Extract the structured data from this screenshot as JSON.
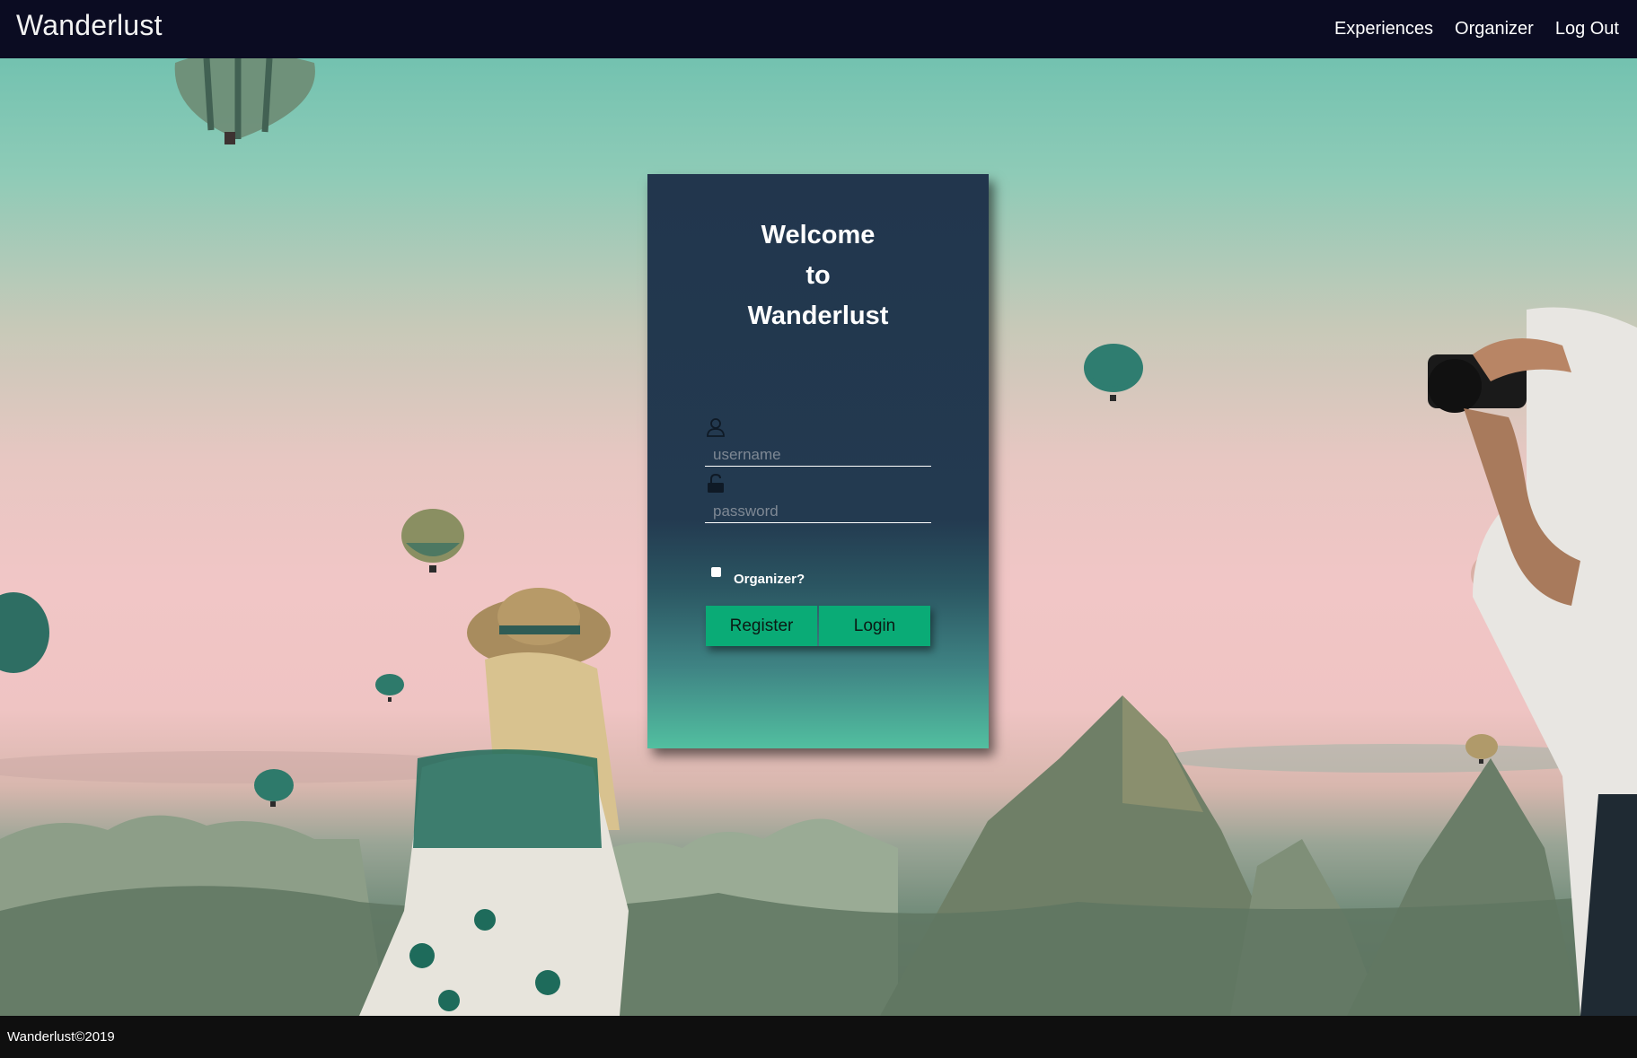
{
  "header": {
    "brand": "Wanderlust",
    "nav": [
      {
        "label": "Experiences"
      },
      {
        "label": "Organizer"
      },
      {
        "label": "Log Out"
      }
    ]
  },
  "login_card": {
    "title_lines": [
      "Welcome",
      "to",
      "Wanderlust"
    ],
    "username": {
      "placeholder": "username",
      "value": "",
      "icon": "user-icon"
    },
    "password": {
      "placeholder": "password",
      "value": "",
      "icon": "unlocked-lock-icon"
    },
    "organizer_checkbox": {
      "label": "Organizer?",
      "checked": false
    },
    "buttons": {
      "register": "Register",
      "login": "Login"
    },
    "button_color": "#0aab76"
  },
  "footer": {
    "text": "Wanderlust©2019"
  },
  "colors": {
    "header_bg": "#0b0c22",
    "card_top": "#22364d",
    "card_bottom": "#52bfa0",
    "footer_bg": "#0f0f0f"
  }
}
